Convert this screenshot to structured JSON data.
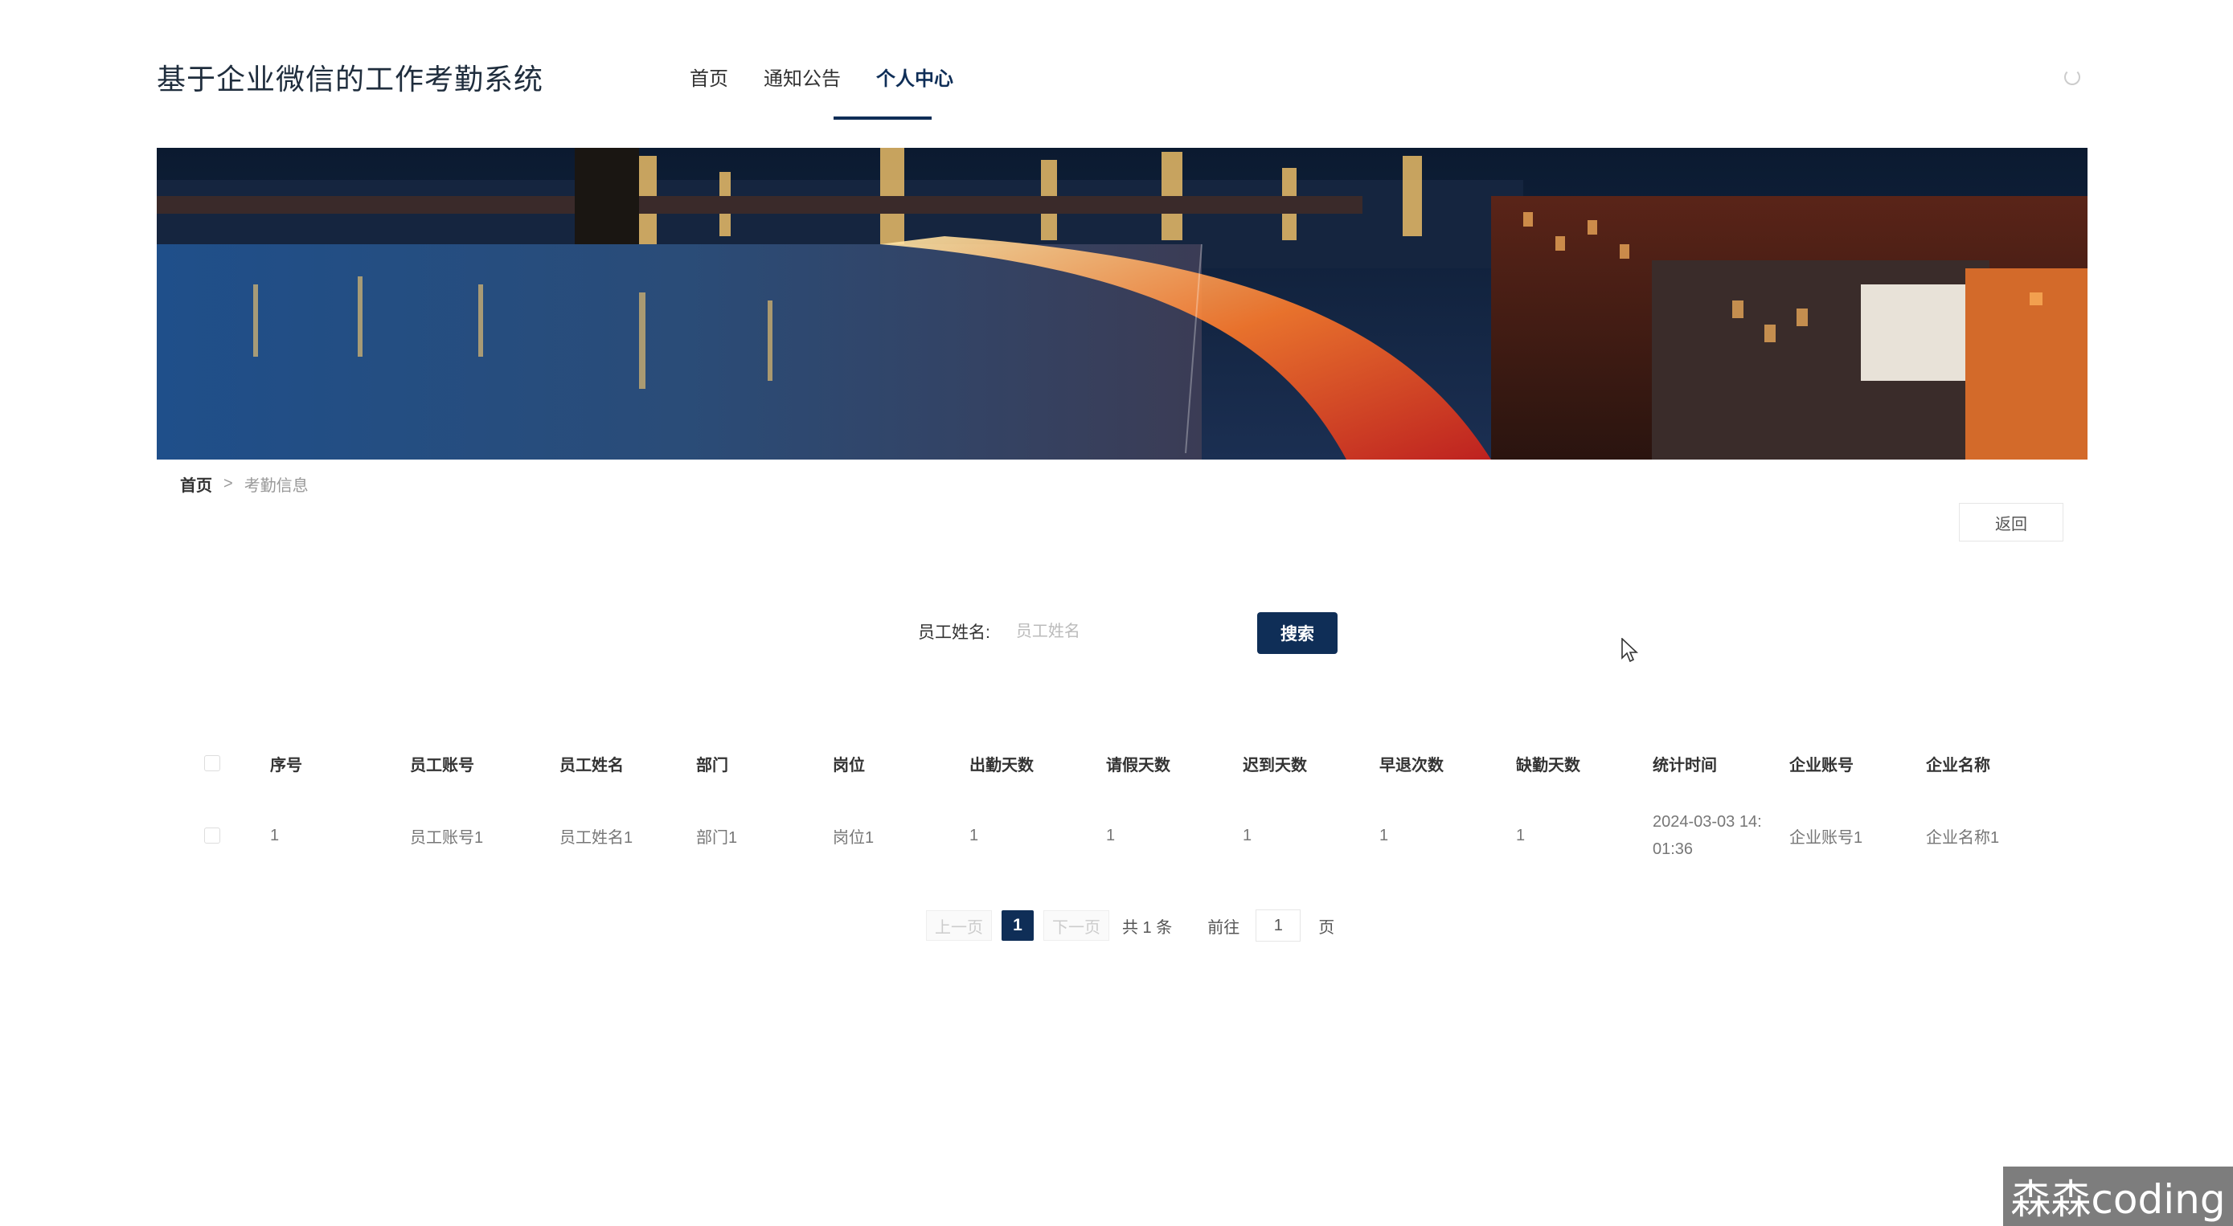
{
  "header": {
    "site_title": "基于企业微信的工作考勤系统",
    "nav": [
      "首页",
      "通知公告",
      "个人中心"
    ],
    "active_nav": "个人中心"
  },
  "breadcrumb": {
    "home": "首页",
    "separator": ">",
    "current": "考勤信息"
  },
  "back_label": "返回",
  "search": {
    "label": "员工姓名:",
    "placeholder": "员工姓名",
    "button_label": "搜索"
  },
  "table": {
    "columns": [
      "序号",
      "员工账号",
      "员工姓名",
      "部门",
      "岗位",
      "出勤天数",
      "请假天数",
      "迟到天数",
      "早退次数",
      "缺勤天数",
      "统计时间",
      "企业账号",
      "企业名称"
    ],
    "rows": [
      {
        "index": "1",
        "employee_account": "员工账号1",
        "employee_name": "员工姓名1",
        "department": "部门1",
        "position": "岗位1",
        "attendance_days": "1",
        "leave_days": "1",
        "late_days": "1",
        "early_leave_count": "1",
        "absence_days": "1",
        "stat_time_date": "2024-03-03 14:",
        "stat_time_rest": "01:36",
        "company_account": "企业账号1",
        "company_name": "企业名称1"
      }
    ]
  },
  "pagination": {
    "prev": "上一页",
    "current": "1",
    "next": "下一页",
    "total": "共 1 条",
    "goto_label": "前往",
    "goto_value": "1",
    "unit": "页"
  },
  "watermark": "森森coding",
  "colors": {
    "primary": "#0f2e57",
    "text": "#333333",
    "muted": "#999999"
  }
}
